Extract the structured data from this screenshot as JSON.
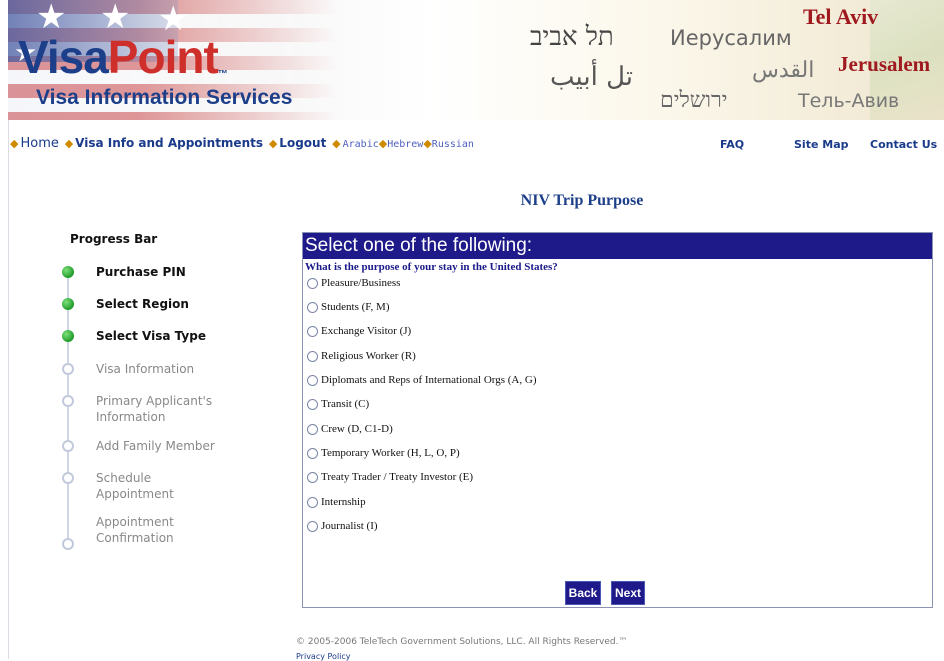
{
  "banner": {
    "logo_visa": "Visa",
    "logo_point": "Point",
    "logo_tm": "™",
    "tagline": "Visa Information Services",
    "cities": {
      "hebrew_tel_aviv": "תל אביב",
      "russian_jerusalem": "Иерусалим",
      "english_tel_aviv": "Tel Aviv",
      "arabic_tel_aviv": "تل أبيب",
      "arabic_jerusalem": "القدس",
      "english_jerusalem": "Jerusalem",
      "hebrew_jerusalem": "ירושלים",
      "russian_tel_aviv": "Тель-Авив"
    }
  },
  "nav": {
    "home": "Home",
    "visa_info": "Visa Info and Appointments",
    "logout": "Logout",
    "arabic": "Arabic",
    "hebrew": "Hebrew",
    "russian": "Russian",
    "separator": "◆",
    "faq": "FAQ",
    "site_map": "Site Map",
    "contact_us": "Contact Us"
  },
  "page_title": "NIV Trip Purpose",
  "progress": {
    "title": "Progress Bar",
    "steps": [
      {
        "label": "Purchase PIN",
        "done": true
      },
      {
        "label": "Select Region",
        "done": true
      },
      {
        "label": "Select Visa Type",
        "done": true
      },
      {
        "label": "Visa Information",
        "done": false
      },
      {
        "label": "Primary Applicant's Information",
        "done": false
      },
      {
        "label": "Add Family Member",
        "done": false
      },
      {
        "label": "Schedule Appointment",
        "done": false
      },
      {
        "label": "Appointment Confirmation",
        "done": false
      }
    ]
  },
  "panel": {
    "header": "Select one of the following:",
    "question": "What is the purpose of your stay in the United States?",
    "options": [
      "Pleasure/Business",
      "Students (F, M)",
      "Exchange Visitor (J)",
      "Religious Worker (R)",
      "Diplomats and Reps of International Orgs (A, G)",
      "Transit (C)",
      "Crew (D, C1-D)",
      "Temporary Worker (H, L, O, P)",
      "Treaty Trader / Treaty Investor (E)",
      "Internship",
      "Journalist (I)"
    ],
    "back_label": "Back",
    "next_label": "Next"
  },
  "footer": {
    "copyright": "© 2005-2006 TeleTech Government Solutions, LLC. All Rights Reserved.™",
    "privacy": "Privacy Policy"
  },
  "colors": {
    "brand_blue": "#1d3f8a",
    "brand_red": "#cf2f2a",
    "panel_header": "#1f1a8a",
    "step_done": "#1f9b2a",
    "city_red": "#a0191f"
  }
}
